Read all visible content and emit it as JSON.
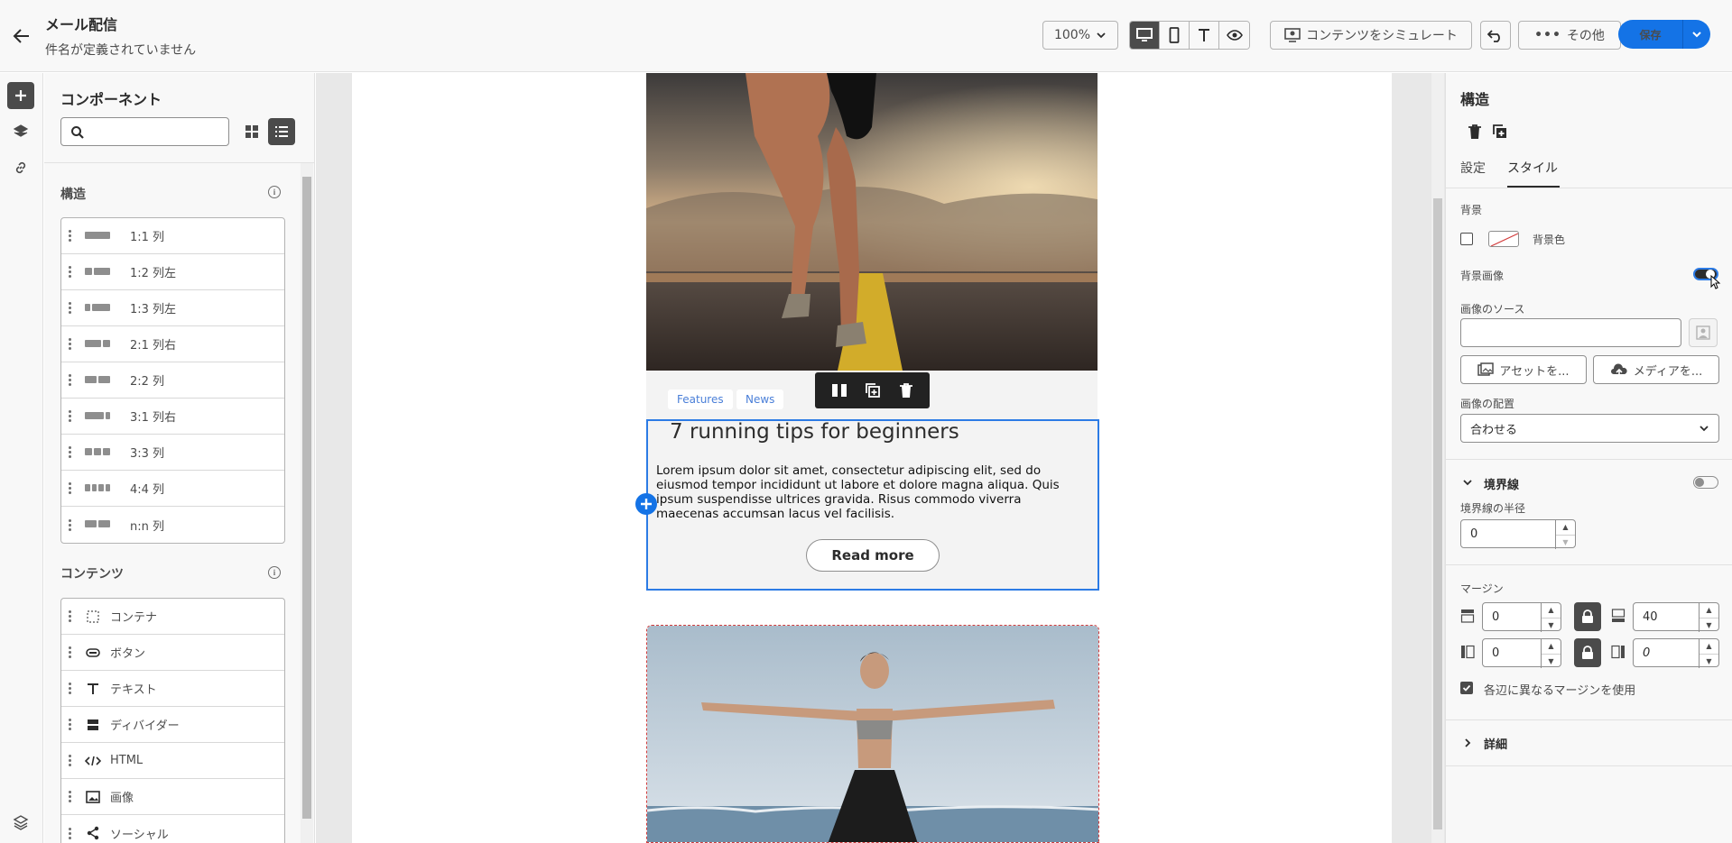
{
  "header": {
    "title": "メール配信",
    "subtitle": "件名が定義されていません",
    "zoom": "100%",
    "simulate_label": "コンテンツをシミュレート",
    "more_label": "その他",
    "save_label": "保存"
  },
  "left_panel": {
    "title": "コンポーネント",
    "search_placeholder": "",
    "structure": {
      "heading": "構造",
      "items": [
        {
          "label": "1:1 列",
          "cols": [
            1
          ]
        },
        {
          "label": "1:2 列左",
          "cols": [
            1,
            2
          ]
        },
        {
          "label": "1:3 列左",
          "cols": [
            1,
            3
          ]
        },
        {
          "label": "2:1 列右",
          "cols": [
            2,
            1
          ]
        },
        {
          "label": "2:2 列",
          "cols": [
            1,
            1
          ]
        },
        {
          "label": "3:1 列右",
          "cols": [
            3,
            1
          ]
        },
        {
          "label": "3:3 列",
          "cols": [
            1,
            1,
            1
          ]
        },
        {
          "label": "4:4 列",
          "cols": [
            1,
            1,
            1,
            1
          ]
        },
        {
          "label": "n:n 列",
          "cols": [
            1,
            1
          ]
        }
      ]
    },
    "content": {
      "heading": "コンテンツ",
      "items": [
        {
          "label": "コンテナ",
          "icon": "container-icon"
        },
        {
          "label": "ボタン",
          "icon": "button-icon"
        },
        {
          "label": "テキスト",
          "icon": "text-icon"
        },
        {
          "label": "ディバイダー",
          "icon": "divider-icon"
        },
        {
          "label": "HTML",
          "icon": "html-icon"
        },
        {
          "label": "画像",
          "icon": "image-icon"
        },
        {
          "label": "ソーシャル",
          "icon": "social-icon"
        }
      ]
    }
  },
  "canvas": {
    "tags": [
      "Features",
      "News"
    ],
    "article_title": "7 running tips for beginners",
    "article_body": "Lorem ipsum dolor sit amet, consectetur adipiscing elit, sed do eiusmod tempor incididunt ut labore et dolore magna aliqua. Quis ipsum suspendisse ultrices gravida. Risus commodo viverra maecenas accumsan lacus vel facilisis.",
    "read_more": "Read more"
  },
  "right_panel": {
    "title": "構造",
    "tabs": [
      "設定",
      "スタイル"
    ],
    "active_tab": "スタイル",
    "background": {
      "heading": "背景",
      "color_label": "背景色",
      "image_label": "背景画像",
      "image_enabled": true,
      "source_label": "画像のソース",
      "source_value": "",
      "asset_button": "アセットを...",
      "media_button": "メディアを...",
      "placement_label": "画像の配置",
      "placement_value": "合わせる"
    },
    "border": {
      "heading": "境界線",
      "enabled": false,
      "radius_label": "境界線の半径",
      "radius_value": "0"
    },
    "margin": {
      "heading": "マージン",
      "top": "0",
      "bottom": "40",
      "left": "0",
      "right": "0",
      "per_side_label": "各辺に異なるマージンを使用",
      "per_side_checked": true
    },
    "details_label": "詳細"
  }
}
